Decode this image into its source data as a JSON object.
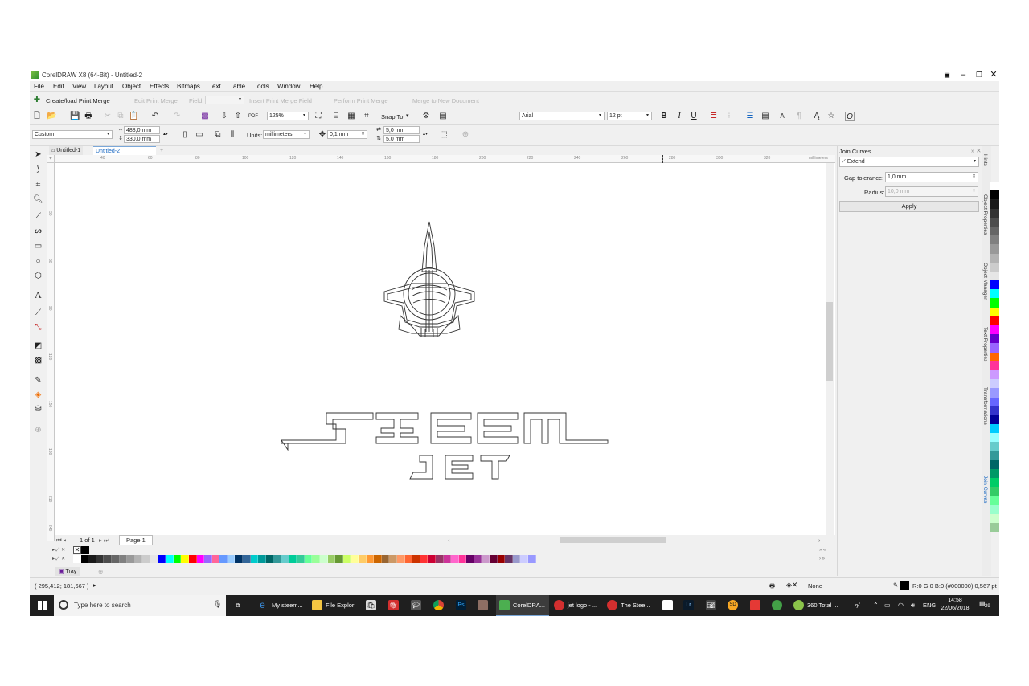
{
  "window": {
    "title": "CorelDRAW X8 (64-Bit) - Untitled-2"
  },
  "menu": [
    "File",
    "Edit",
    "View",
    "Layout",
    "Object",
    "Effects",
    "Bitmaps",
    "Text",
    "Table",
    "Tools",
    "Window",
    "Help"
  ],
  "merge_toolbar": {
    "create_load": "Create/load Print Merge",
    "edit": "Edit Print Merge",
    "field_label": "Field:",
    "insert": "Insert Print Merge Field",
    "perform": "Perform Print Merge",
    "merge_new": "Merge to New Document"
  },
  "standard_toolbar": {
    "zoom": "125%",
    "snap_to": "Snap To",
    "font_name": "Arial",
    "font_size": "12 pt"
  },
  "property_bar": {
    "page_preset": "Custom",
    "width": "488,0 mm",
    "height": "330,0 mm",
    "units_label": "Units:",
    "units": "millimeters",
    "nudge": "0,1 mm",
    "dup_x": "5,0 mm",
    "dup_y": "5,0 mm"
  },
  "doc_tabs": [
    "Untitled-1",
    "Untitled-2"
  ],
  "ruler": {
    "h_ticks": [
      "40",
      "60",
      "80",
      "100",
      "120",
      "140",
      "160",
      "180",
      "200",
      "220",
      "240",
      "260",
      "280",
      "300",
      "320",
      "340"
    ],
    "unit": "millimeters",
    "v_ticks": [
      "30",
      "60",
      "90",
      "120",
      "150",
      "180",
      "210",
      "240"
    ]
  },
  "page_nav": {
    "count": "1 of 1",
    "page_tab": "Page 1"
  },
  "tray": {
    "label": "Tray"
  },
  "status": {
    "coords": "( 295,412; 181,667 )",
    "fill_none": "None",
    "outline": "R:0 G:0 B:0 (#000000)  0,567 pt"
  },
  "docker": {
    "title": "Join Curves",
    "method": "Extend",
    "gap_label": "Gap tolerance:",
    "gap_value": "1,0 mm",
    "radius_label": "Radius:",
    "radius_value": "10,0 mm",
    "apply": "Apply"
  },
  "docker_tabs": [
    "Hints",
    "Object Properties",
    "Object Manager",
    "Text Properties",
    "Transformations",
    "Join Curves"
  ],
  "artwork": {
    "word_1": "STEEM",
    "word_2": "JET"
  },
  "palette_colors": [
    "#ffffff",
    "#000000",
    "#1a1a1a",
    "#333333",
    "#4d4d4d",
    "#666666",
    "#808080",
    "#999999",
    "#b3b3b3",
    "#cccccc",
    "#e6e6e6",
    "#0000ff",
    "#00ffff",
    "#00ff00",
    "#ffff00",
    "#ff0000",
    "#ff00ff",
    "#9966ff",
    "#ff6699",
    "#6699ff",
    "#99ccff",
    "#003366",
    "#336699",
    "#00cccc",
    "#009999",
    "#006666",
    "#339999",
    "#66cccc",
    "#00cc99",
    "#33cc99",
    "#66ff99",
    "#99ff99",
    "#ccffcc",
    "#99cc66",
    "#669933",
    "#ccff66",
    "#ffff99",
    "#ffcc66",
    "#ff9933",
    "#cc6600",
    "#996633",
    "#cc9966",
    "#ff9966",
    "#ff6633",
    "#cc3300",
    "#ff3333",
    "#cc0033",
    "#993366",
    "#cc3399",
    "#ff66cc",
    "#ff3399",
    "#660066",
    "#993399",
    "#cc99cc",
    "#660033",
    "#990000",
    "#663366",
    "#9999cc",
    "#ccccff",
    "#9999ff"
  ],
  "right_palette": [
    "#ffffff",
    "#000000",
    "#1a1a1a",
    "#333333",
    "#4d4d4d",
    "#666666",
    "#808080",
    "#999999",
    "#b3b3b3",
    "#cccccc",
    "#e6e6e6",
    "#0000ff",
    "#00ffff",
    "#00ff00",
    "#ffff00",
    "#ff0000",
    "#ff00ff",
    "#6600cc",
    "#9966ff",
    "#ff6600",
    "#ff3399",
    "#cc99ff",
    "#ccccff",
    "#9999ff",
    "#6666ff",
    "#3333cc",
    "#000099",
    "#00ccff",
    "#99ffff",
    "#66cccc",
    "#339999",
    "#006666",
    "#009966",
    "#00cc66",
    "#33cc66",
    "#66ff99",
    "#99ffcc",
    "#ccffcc",
    "#99cc99"
  ],
  "taskbar": {
    "search": "Type here to search",
    "items": [
      "My steem...",
      "File Explor",
      "CorelDRA...",
      "jet logo - ...",
      "The Stee...",
      "360 Total ..."
    ],
    "lang": "ENG",
    "time": "14:58",
    "date": "22/06/2018",
    "notif_count": "29"
  }
}
